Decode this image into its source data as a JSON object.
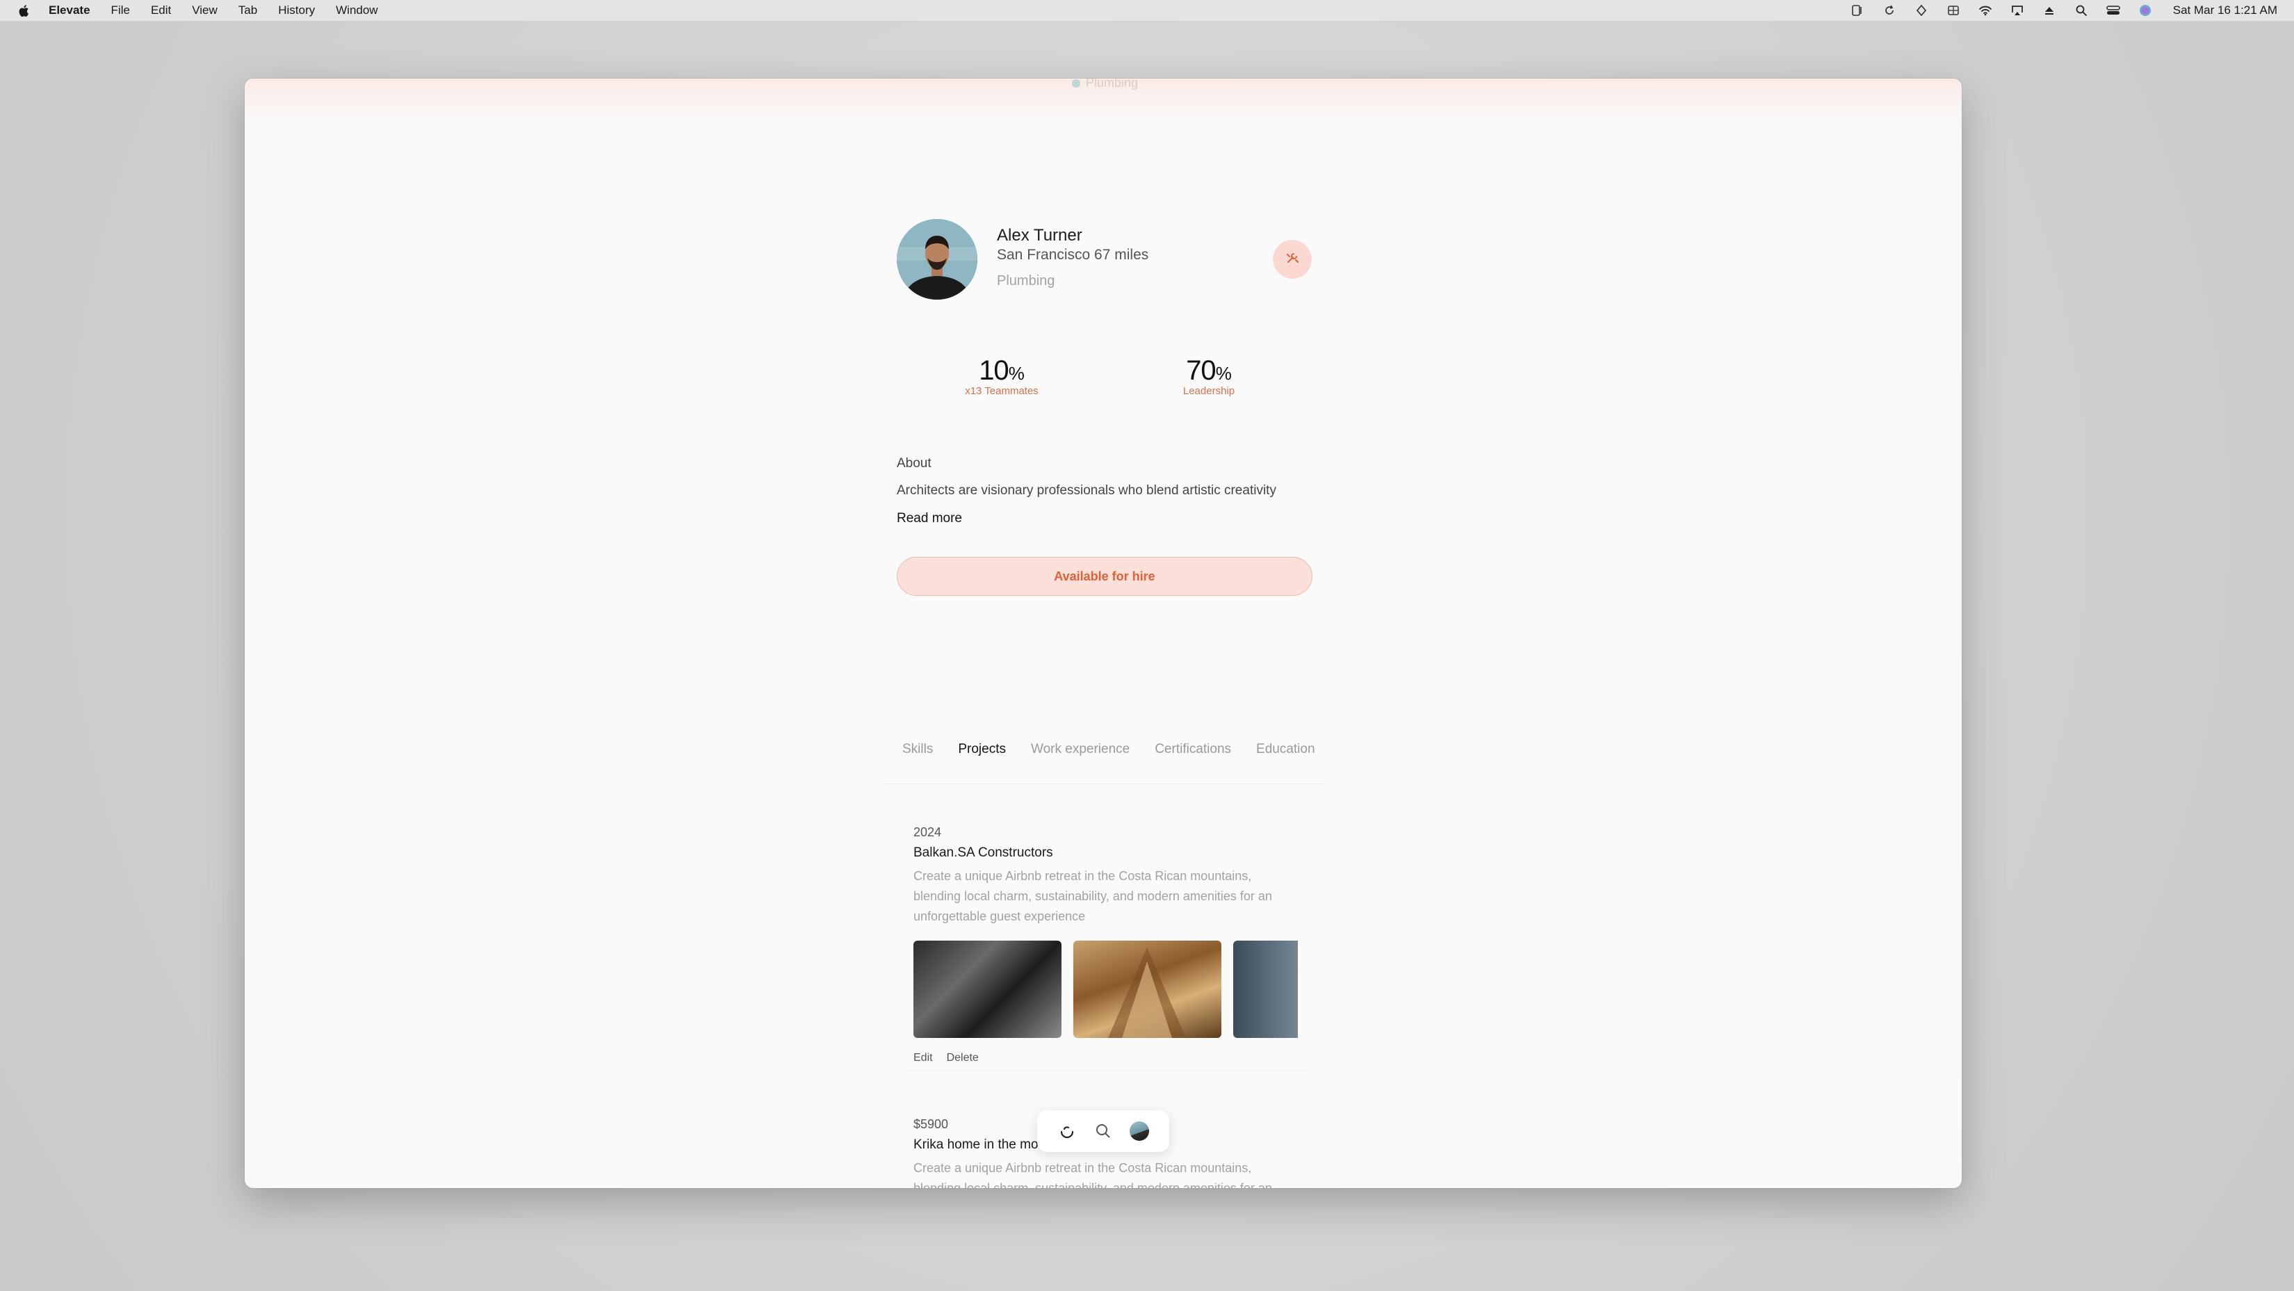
{
  "menubar": {
    "app_name": "Elevate",
    "menus": [
      "File",
      "Edit",
      "View",
      "Tab",
      "History",
      "Window"
    ],
    "clock": "Sat Mar 16  1:21 AM",
    "status_icons": [
      "screen-mirror-icon",
      "refresh-icon",
      "vpn-icon",
      "grid-icon",
      "wifi-icon",
      "airplay-icon",
      "eject-icon",
      "search-icon",
      "control-center-icon",
      "siri-icon"
    ]
  },
  "window": {
    "ghost_label": "Plumbing"
  },
  "profile": {
    "name": "Alex Turner",
    "location": "San Francisco 67 miles",
    "trade": "Plumbing",
    "tool_icon": "wrench-icon"
  },
  "stats": [
    {
      "value": "10",
      "unit": "%",
      "label": "x13 Teammates"
    },
    {
      "value": "70",
      "unit": "%",
      "label": "Leadership"
    }
  ],
  "about": {
    "title": "About",
    "text": "Architects are visionary professionals who blend artistic creativity",
    "read_more": "Read more"
  },
  "hire_button": "Available for hire",
  "tabs": [
    {
      "label": "Skills",
      "active": false
    },
    {
      "label": "Projects",
      "active": true
    },
    {
      "label": "Work experience",
      "active": false
    },
    {
      "label": "Certifications",
      "active": false
    },
    {
      "label": "Education",
      "active": false
    }
  ],
  "projects": [
    {
      "meta": "2024",
      "title": "Balkan.SA Constructors",
      "description": "Create a unique Airbnb retreat in the Costa Rican mountains, blending local charm, sustainability, and modern amenities for an unforgettable guest experience",
      "edit": "Edit",
      "delete": "Delete"
    },
    {
      "meta": "$5900",
      "title": "Krika home in the mountains of Costa Rica",
      "description": "Create a unique Airbnb retreat in the Costa Rican mountains, blending local charm, sustainability, and modern amenities for an unforgettable guest experience"
    }
  ],
  "dock": {
    "icons": [
      "swirl-icon",
      "search-icon",
      "profile-avatar"
    ]
  },
  "colors": {
    "accent": "#e36d45",
    "hire_bg": "#fbe0d9",
    "window_bg": "#f9f9f9"
  }
}
